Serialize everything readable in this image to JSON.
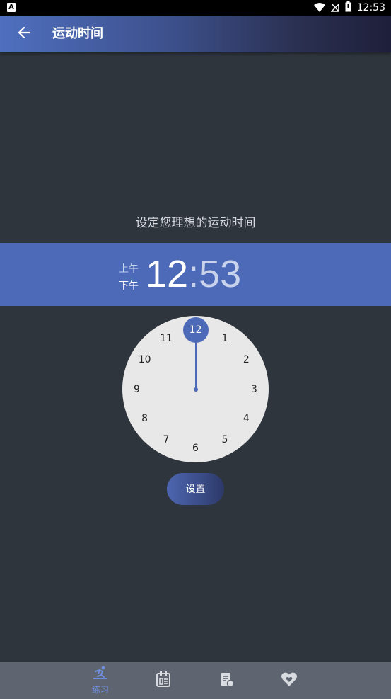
{
  "status_bar": {
    "left_icon": "A",
    "time": "12:53",
    "icons": [
      "wifi-icon",
      "no-signal-icon",
      "battery-icon"
    ]
  },
  "app_bar": {
    "back_icon": "arrow-left-icon",
    "title": "运动时间"
  },
  "prompt": "设定您理想的运动时间",
  "time_picker": {
    "am_label": "上午",
    "pm_label": "下午",
    "selected_period": "下午",
    "hour": "12",
    "separator": ":",
    "minute": "53",
    "accent_color": "#4d6ab8"
  },
  "clock": {
    "numbers": [
      "12",
      "1",
      "2",
      "3",
      "4",
      "5",
      "6",
      "7",
      "8",
      "9",
      "10",
      "11"
    ],
    "selected": "12"
  },
  "set_button": {
    "label": "设置"
  },
  "bottom_nav": {
    "items": [
      {
        "icon": "exercise-icon",
        "label": "练习",
        "active": true
      },
      {
        "icon": "calendar-icon",
        "label": "",
        "active": false
      },
      {
        "icon": "report-icon",
        "label": "",
        "active": false
      },
      {
        "icon": "heart-icon",
        "label": "",
        "active": false
      }
    ],
    "active_color": "#6f8ee0",
    "inactive_color": "#d8dbe0"
  }
}
